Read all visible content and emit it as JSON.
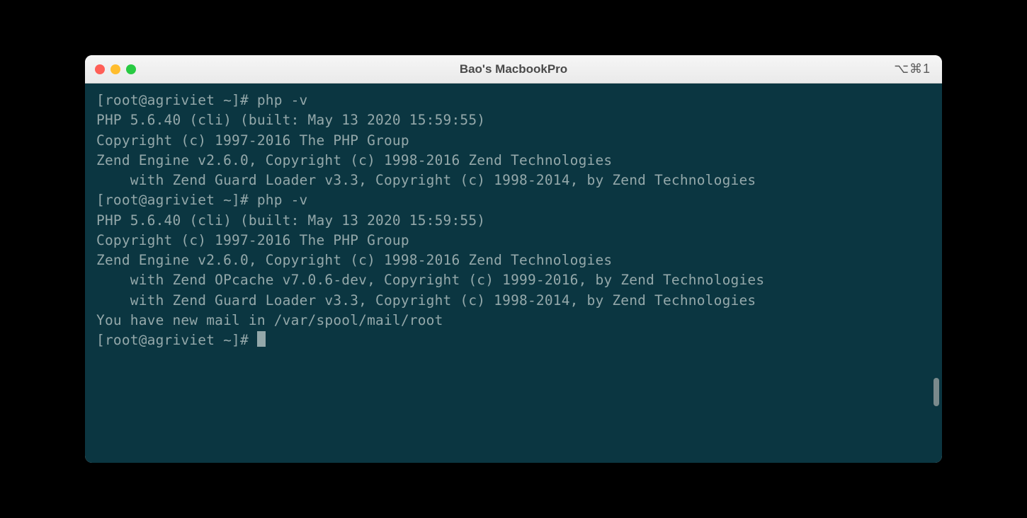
{
  "window": {
    "title": "Bao's MacbookPro",
    "shortcut": "⌥⌘1"
  },
  "terminal": {
    "lines": [
      "[root@agriviet ~]# php -v",
      "PHP 5.6.40 (cli) (built: May 13 2020 15:59:55)",
      "Copyright (c) 1997-2016 The PHP Group",
      "Zend Engine v2.6.0, Copyright (c) 1998-2016 Zend Technologies",
      "    with Zend Guard Loader v3.3, Copyright (c) 1998-2014, by Zend Technologies",
      "[root@agriviet ~]# php -v",
      "PHP 5.6.40 (cli) (built: May 13 2020 15:59:55)",
      "Copyright (c) 1997-2016 The PHP Group",
      "Zend Engine v2.6.0, Copyright (c) 1998-2016 Zend Technologies",
      "    with Zend OPcache v7.0.6-dev, Copyright (c) 1999-2016, by Zend Technologies",
      "    with Zend Guard Loader v3.3, Copyright (c) 1998-2014, by Zend Technologies",
      "You have new mail in /var/spool/mail/root"
    ],
    "prompt": "[root@agriviet ~]# "
  }
}
